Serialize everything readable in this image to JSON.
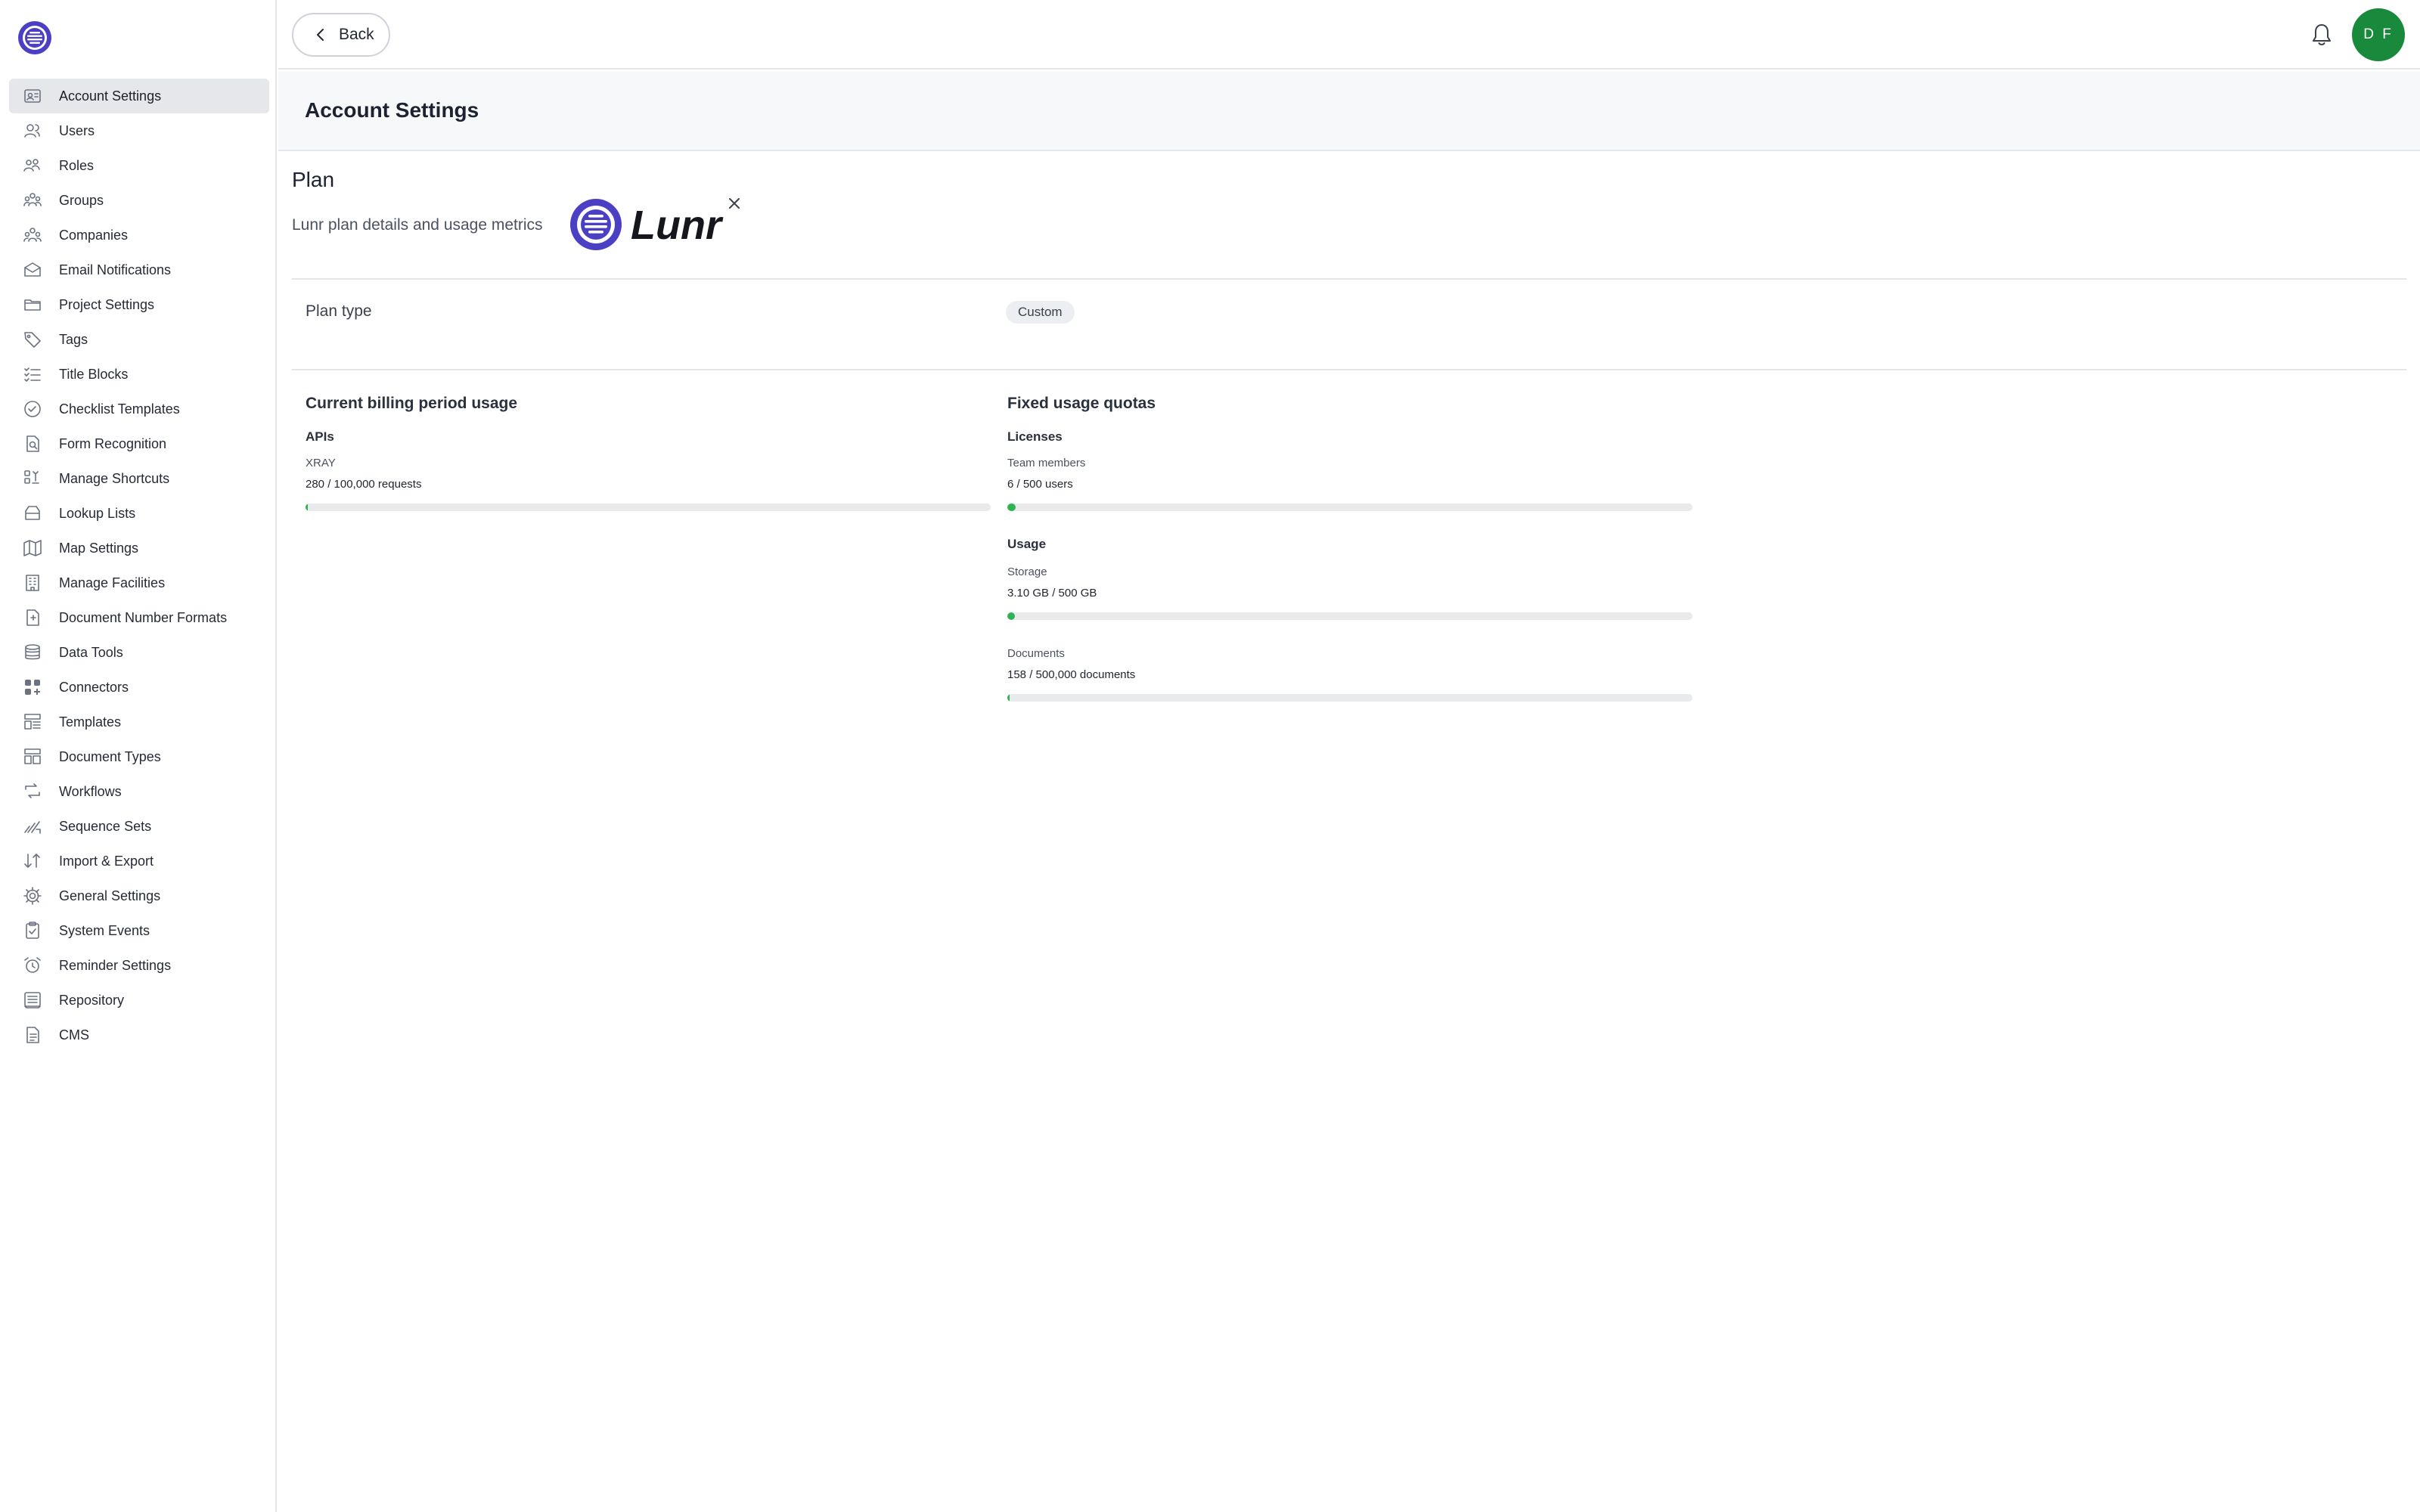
{
  "sidebar": {
    "items": [
      {
        "label": "Account Settings",
        "icon": "account-settings-icon",
        "active": true
      },
      {
        "label": "Users",
        "icon": "users-icon"
      },
      {
        "label": "Roles",
        "icon": "roles-icon"
      },
      {
        "label": "Groups",
        "icon": "groups-icon"
      },
      {
        "label": "Companies",
        "icon": "companies-icon"
      },
      {
        "label": "Email Notifications",
        "icon": "envelope-icon"
      },
      {
        "label": "Project Settings",
        "icon": "folder-icon"
      },
      {
        "label": "Tags",
        "icon": "tag-icon"
      },
      {
        "label": "Title Blocks",
        "icon": "checklist-icon"
      },
      {
        "label": "Checklist Templates",
        "icon": "check-circle-icon"
      },
      {
        "label": "Form Recognition",
        "icon": "form-search-icon"
      },
      {
        "label": "Manage Shortcuts",
        "icon": "shortcuts-icon"
      },
      {
        "label": "Lookup Lists",
        "icon": "lookup-icon"
      },
      {
        "label": "Map Settings",
        "icon": "map-icon"
      },
      {
        "label": "Manage Facilities",
        "icon": "building-icon"
      },
      {
        "label": "Document Number Formats",
        "icon": "document-number-icon"
      },
      {
        "label": "Data Tools",
        "icon": "database-icon"
      },
      {
        "label": "Connectors",
        "icon": "connectors-icon"
      },
      {
        "label": "Templates",
        "icon": "templates-icon"
      },
      {
        "label": "Document Types",
        "icon": "document-types-icon"
      },
      {
        "label": "Workflows",
        "icon": "workflow-icon"
      },
      {
        "label": "Sequence Sets",
        "icon": "sequence-icon"
      },
      {
        "label": "Import & Export",
        "icon": "import-export-icon"
      },
      {
        "label": "General Settings",
        "icon": "gear-icon"
      },
      {
        "label": "System Events",
        "icon": "clipboard-check-icon"
      },
      {
        "label": "Reminder Settings",
        "icon": "alarm-clock-icon"
      },
      {
        "label": "Repository",
        "icon": "repository-icon"
      },
      {
        "label": "CMS",
        "icon": "file-text-icon"
      }
    ]
  },
  "topbar": {
    "back_label": "Back",
    "avatar_initials": "D F",
    "avatar_color": "#198a3c"
  },
  "page": {
    "title": "Account Settings"
  },
  "plan": {
    "heading": "Plan",
    "description": "Lunr plan details and usage metrics",
    "logo_text": "Lunr",
    "type_label": "Plan type",
    "type_value": "Custom"
  },
  "usage": {
    "billing_heading": "Current billing period usage",
    "apis": {
      "heading": "APIs",
      "items": [
        {
          "label": "XRAY",
          "value": "280 / 100,000 requests",
          "fraction": 0.0028
        }
      ]
    },
    "quotas_heading": "Fixed usage quotas",
    "licenses": {
      "heading": "Licenses",
      "items": [
        {
          "label": "Team members",
          "value": "6 / 500 users",
          "fraction": 0.012
        }
      ]
    },
    "usage_section": {
      "heading": "Usage",
      "items": [
        {
          "label": "Storage",
          "value": "3.10 GB / 500 GB",
          "fraction": 0.0062
        },
        {
          "label": "Documents",
          "value": "158 / 500,000 documents",
          "fraction": 0.0003
        }
      ]
    },
    "bar_color": "#2fb454"
  }
}
